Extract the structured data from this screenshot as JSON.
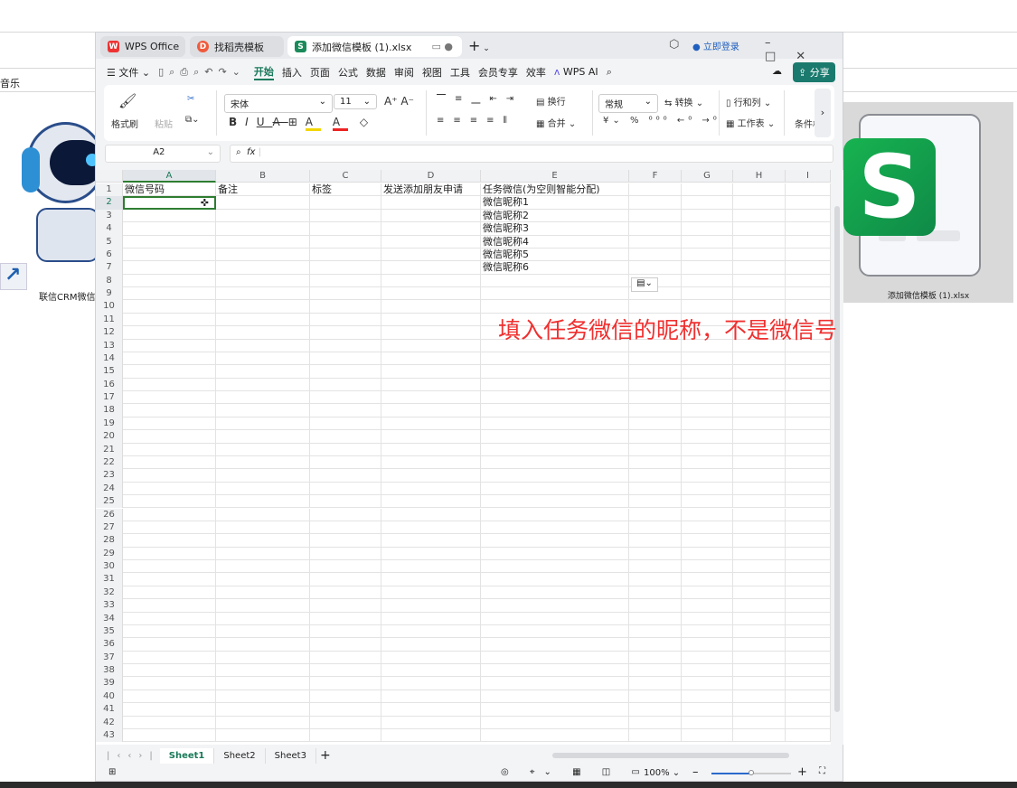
{
  "desktop": {
    "top_left_text": "音乐",
    "left_shortcut_label": "联信CRM微信",
    "right_file_label": "添加微信模板 (1).xlsx"
  },
  "tabs": [
    {
      "label": "WPS Office",
      "icon": "wps-logo-icon"
    },
    {
      "label": "找稻壳模板",
      "icon": "docer-icon"
    },
    {
      "label": "添加微信模板 (1).xlsx",
      "icon": "spreadsheet-icon",
      "active": true
    }
  ],
  "titlebar": {
    "login": "立即登录",
    "new_tab": "+"
  },
  "menu": {
    "file": "文件",
    "items": [
      "开始",
      "插入",
      "页面",
      "公式",
      "数据",
      "审阅",
      "视图",
      "工具",
      "会员专享",
      "效率"
    ],
    "active": "开始",
    "ai": "WPS AI",
    "share": "分享"
  },
  "ribbon": {
    "format_painter": "格式刷",
    "paste": "粘贴",
    "font": "宋体",
    "size": "11",
    "bold": "B",
    "italic": "I",
    "underline": "U",
    "wrap": "换行",
    "merge": "合并",
    "number_format": "常规",
    "convert": "转换",
    "rows_cols": "行和列",
    "worksheet": "工作表",
    "conditional": "条件格",
    "currency": "¥",
    "percent": "%"
  },
  "formula_bar": {
    "name_box": "A2",
    "fx": "fx",
    "value": ""
  },
  "columns": [
    "A",
    "B",
    "C",
    "D",
    "E",
    "F",
    "G",
    "H",
    "I"
  ],
  "row_count": 43,
  "cells": {
    "A1": "微信号码",
    "B1": "备注",
    "C1": "标签",
    "D1": "发送添加朋友申请",
    "E1": "任务微信(为空则智能分配)",
    "E2": "微信昵称1",
    "E3": "微信昵称2",
    "E4": "微信昵称3",
    "E5": "微信昵称4",
    "E6": "微信昵称5",
    "E7": "微信昵称6"
  },
  "selected_cell": "A2",
  "annotation": "填入任务微信的昵称，不是微信号",
  "sheets": [
    "Sheet1",
    "Sheet2",
    "Sheet3"
  ],
  "active_sheet": "Sheet1",
  "status": {
    "zoom": "100%",
    "zoom_level": 0.5
  },
  "colors": {
    "accent": "#1a7a5b",
    "annotation": "#f03030",
    "selection": "#2e7d32"
  }
}
